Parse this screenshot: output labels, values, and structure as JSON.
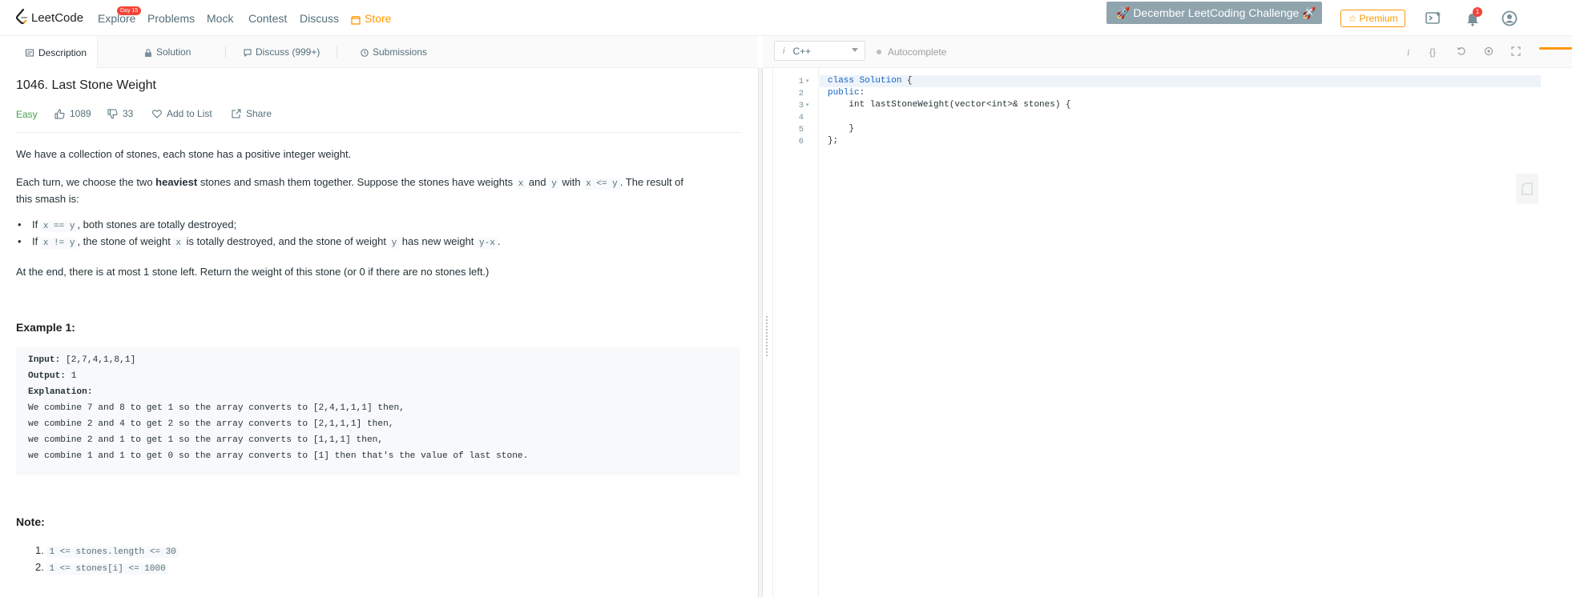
{
  "nav": {
    "logo": "LeetCode",
    "explore": "Explore",
    "explore_badge": "Day 15",
    "problems": "Problems",
    "mock": "Mock",
    "contest": "Contest",
    "discuss": "Discuss",
    "store": "Store",
    "challenge": "🚀 December LeetCoding Challenge 🚀",
    "premium": "☆ Premium",
    "notifications_count": "1"
  },
  "tabs": {
    "description": "Description",
    "solution": "Solution",
    "discuss": "Discuss (999+)",
    "submissions": "Submissions"
  },
  "problem": {
    "title": "1046. Last Stone Weight",
    "difficulty": "Easy",
    "likes": "1089",
    "dislikes": "33",
    "add_to_list": "Add to List",
    "share": "Share",
    "p1": "We have a collection of stones, each stone has a positive integer weight.",
    "p2_a": "Each turn, we choose the two ",
    "p2_bold": "heaviest",
    "p2_b": " stones and smash them together.  Suppose the stones have weights ",
    "p2_x": "x",
    "p2_and": " and ",
    "p2_y": "y",
    "p2_with": " with ",
    "p2_cond": "x <= y",
    "p2_c": ". The result of",
    "p2_line2": "this smash is:",
    "b1_if": "If ",
    "b1_code": "x == y",
    "b1_rest": ", both stones are totally destroyed;",
    "b2_if": "If ",
    "b2_code": "x != y",
    "b2_mid": ", the stone of weight ",
    "b2_x": "x",
    "b2_mid2": " is totally destroyed, and the stone of weight ",
    "b2_y": "y",
    "b2_mid3": " has new weight ",
    "b2_expr": "y-x",
    "b2_end": ".",
    "p3": "At the end, there is at most 1 stone left.  Return the weight of this stone (or 0 if there are no stones left.)",
    "example_heading": "Example 1:",
    "example": {
      "input_label": "Input:",
      "input_value": " [2,7,4,1,8,1]",
      "output_label": "Output:",
      "output_value": " 1",
      "explanation_label": "Explanation:",
      "lines": [
        "We combine 7 and 8 to get 1 so the array converts to [2,4,1,1,1] then,",
        "we combine 2 and 4 to get 2 so the array converts to [2,1,1,1] then,",
        "we combine 2 and 1 to get 1 so the array converts to [1,1,1] then,",
        "we combine 1 and 1 to get 0 so the array converts to [1] then that's the value of last stone."
      ]
    },
    "note_heading": "Note:",
    "notes": [
      {
        "num": "1.",
        "text": "1 <= stones.length <= 30"
      },
      {
        "num": "2.",
        "text": "1 <= stones[i] <= 1000"
      }
    ]
  },
  "editor": {
    "lang_prefix": "i",
    "language": "C++",
    "autocomplete": "Autocomplete",
    "line_numbers": [
      "1",
      "2",
      "3",
      "4",
      "5",
      "6"
    ],
    "code_lines": [
      {
        "kw": "class Solution",
        "rest": " {"
      },
      {
        "kw": "public",
        "rest": ":"
      },
      {
        "kw": "",
        "rest": "    int lastStoneWeight(vector<int>& stones) {"
      },
      {
        "kw": "",
        "rest": ""
      },
      {
        "kw": "",
        "rest": "    }"
      },
      {
        "kw": "",
        "rest": "};"
      }
    ]
  }
}
